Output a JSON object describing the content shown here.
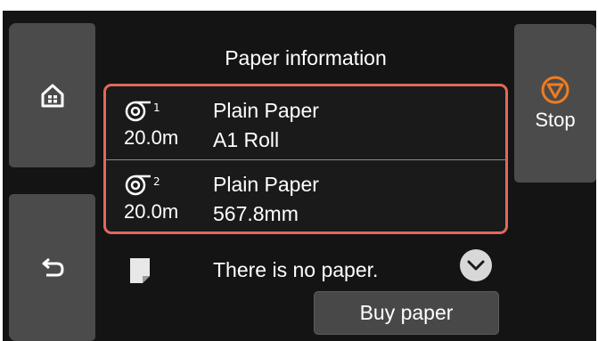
{
  "header": {
    "title": "Paper information"
  },
  "side": {
    "home_icon": "home-icon",
    "back_icon": "back-arrow-icon",
    "stop_label": "Stop",
    "stop_icon": "stop-icon"
  },
  "rolls": [
    {
      "icon": "roll-1-icon",
      "length": "20.0m",
      "type": "Plain Paper",
      "size": "A1 Roll"
    },
    {
      "icon": "roll-2-icon",
      "length": "20.0m",
      "type": "Plain Paper",
      "size": "567.8mm"
    }
  ],
  "sheet": {
    "icon": "sheet-paper-icon",
    "status": "There is no paper."
  },
  "actions": {
    "buy_label": "Buy paper",
    "expand_icon": "chevron-down-icon"
  },
  "colors": {
    "background": "#141414",
    "button": "#4b4b4b",
    "highlight_border": "#e2685a",
    "stop_accent": "#f07c20"
  }
}
